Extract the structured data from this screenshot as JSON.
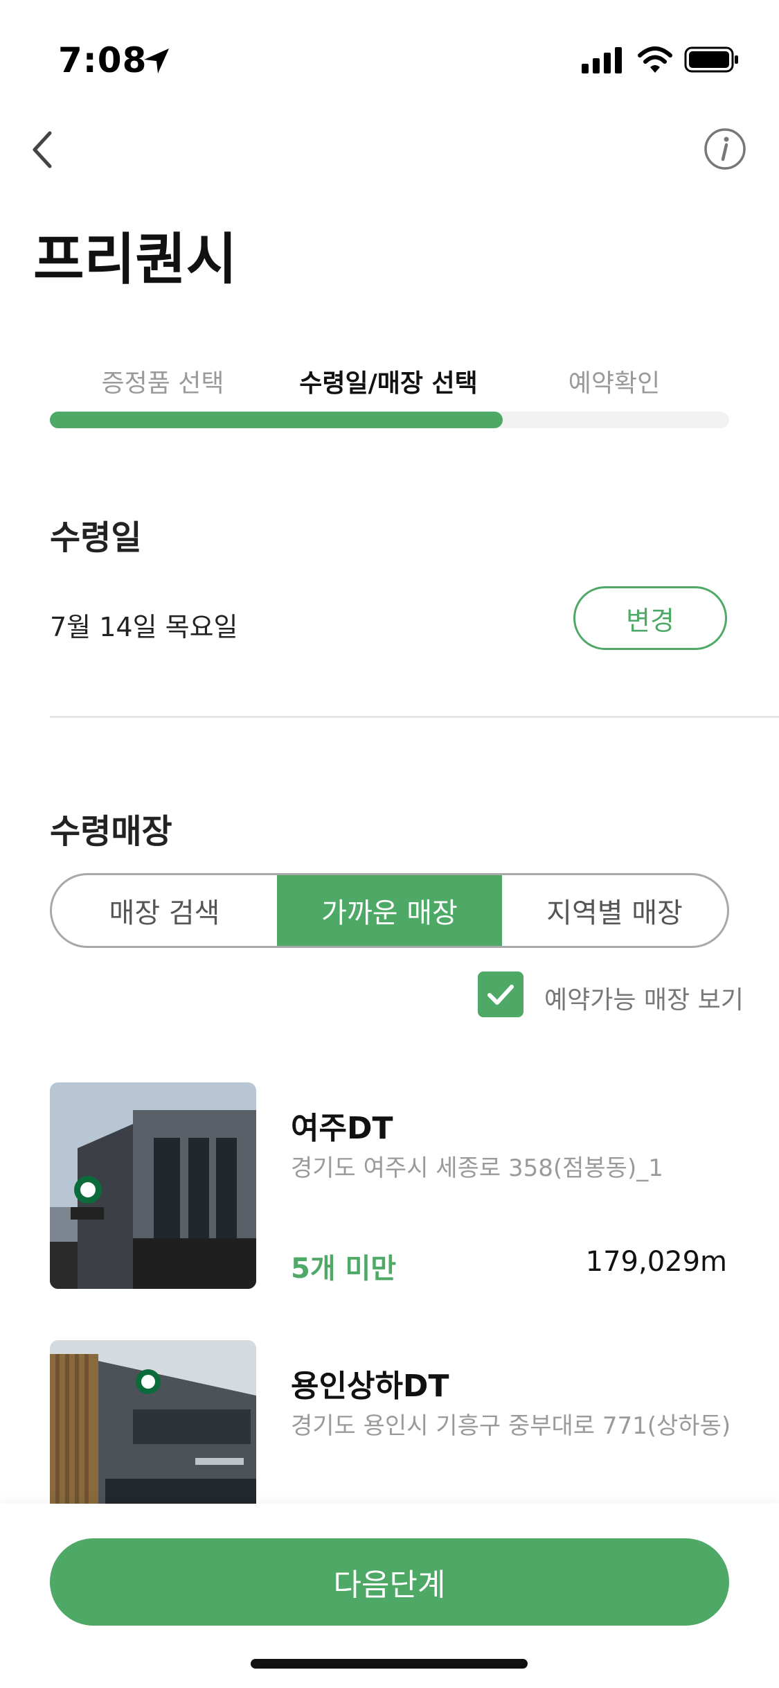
{
  "status_bar": {
    "time": "7:08"
  },
  "header": {
    "title": "프리퀀시"
  },
  "steps": {
    "items": [
      "증정품 선택",
      "수령일/매장 선택",
      "예약확인"
    ],
    "active_index": 1,
    "progress_fraction": 0.667
  },
  "pickup_date": {
    "title": "수령일",
    "value": "7월 14일 목요일",
    "change_label": "변경"
  },
  "pickup_store": {
    "title": "수령매장",
    "tabs": [
      "매장 검색",
      "가까운 매장",
      "지역별 매장"
    ],
    "active_tab": 1,
    "filter_label": "예약가능 매장 보기",
    "filter_checked": true,
    "stores": [
      {
        "name": "여주DT",
        "address": "경기도 여주시 세종로 358(점봉동)_1",
        "stock": "5개 미만",
        "distance": "179,029m"
      },
      {
        "name": "용인상하DT",
        "address": "경기도 용인시 기흥구 중부대로 771(상하동)"
      }
    ]
  },
  "footer": {
    "next_label": "다음단계"
  },
  "colors": {
    "accent": "#4ea866",
    "muted": "#9a9a9a"
  },
  "icons": [
    "location-arrow-icon",
    "signal-icon",
    "wifi-icon",
    "battery-icon",
    "back-chevron-icon",
    "info-icon",
    "checkmark-icon"
  ]
}
